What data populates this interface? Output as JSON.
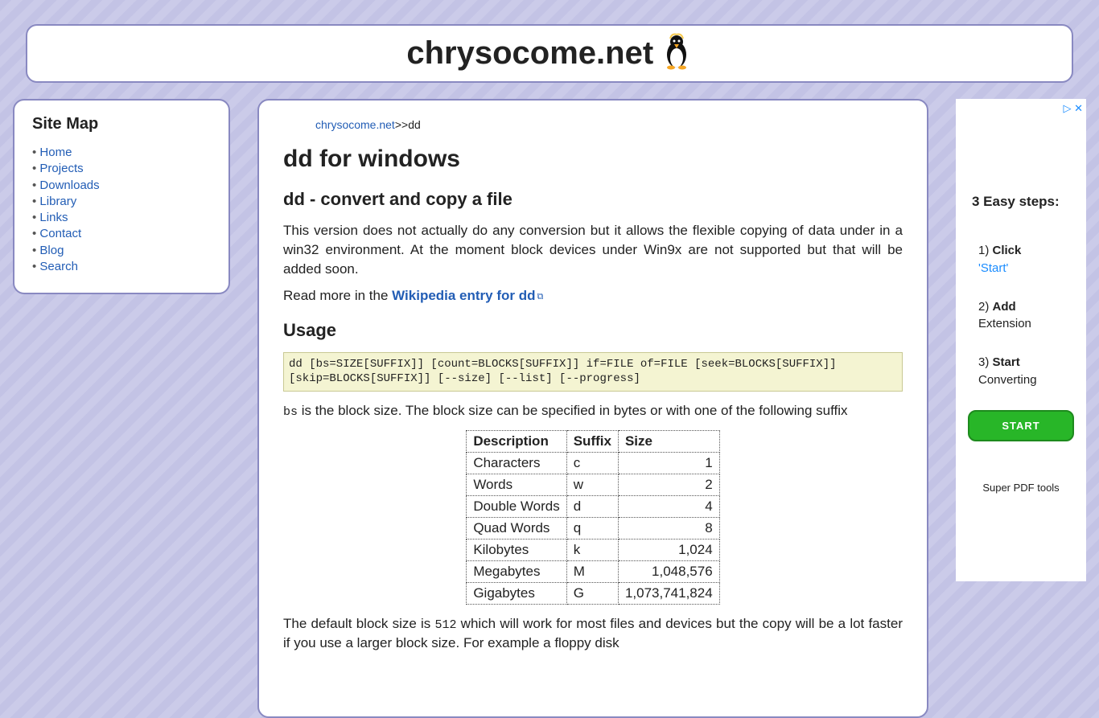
{
  "header": {
    "site_title": "chrysocome.net"
  },
  "sidebar": {
    "title": "Site Map",
    "items": [
      "Home",
      "Projects",
      "Downloads",
      "Library",
      "Links",
      "Contact",
      "Blog",
      "Search"
    ]
  },
  "breadcrumb": {
    "root": "chrysocome.net",
    "sep": ">>",
    "current": "dd"
  },
  "content": {
    "page_title": "dd for windows",
    "subtitle": "dd - convert and copy a file",
    "intro": "This version does not actually do any conversion but it allows the flexible copying of data under in a win32 environment. At the moment block devices under Win9x are not supported but that will be added soon.",
    "readmore_pre": "Read more in the ",
    "readmore_link": "Wikipedia entry for dd",
    "usage_heading": "Usage",
    "usage_text": "dd [bs=SIZE[SUFFIX]] [count=BLOCKS[SUFFIX]] if=FILE of=FILE [seek=BLOCKS[SUFFIX]] [skip=BLOCKS[SUFFIX]] [--size] [--list] [--progress]",
    "bs_code": "bs",
    "bs_desc": " is the block size. The block size can be specified in bytes or with one of the following suffix",
    "table_headers": [
      "Description",
      "Suffix",
      "Size"
    ],
    "table_rows": [
      {
        "desc": "Characters",
        "suffix": "c",
        "size": "1"
      },
      {
        "desc": "Words",
        "suffix": "w",
        "size": "2"
      },
      {
        "desc": "Double Words",
        "suffix": "d",
        "size": "4"
      },
      {
        "desc": "Quad Words",
        "suffix": "q",
        "size": "8"
      },
      {
        "desc": "Kilobytes",
        "suffix": "k",
        "size": "1,024"
      },
      {
        "desc": "Megabytes",
        "suffix": "M",
        "size": "1,048,576"
      },
      {
        "desc": "Gigabytes",
        "suffix": "G",
        "size": "1,073,741,824"
      }
    ],
    "default_pre": "The default block size is ",
    "default_code": "512",
    "default_post": " which will work for most files and devices but the copy will be a lot faster if you use a larger block size. For example a floppy disk"
  },
  "ad": {
    "close_glyph": "▷ ✕",
    "title": "3 Easy steps:",
    "step1_n": "1) ",
    "step1_b": "Click",
    "step1_accent": "'Start'",
    "step2_n": "2) ",
    "step2_b": "Add",
    "step2_rest": "Extension",
    "step3_n": "3) ",
    "step3_b": "Start",
    "step3_rest": "Converting",
    "button": "START",
    "footer": "Super PDF tools"
  }
}
